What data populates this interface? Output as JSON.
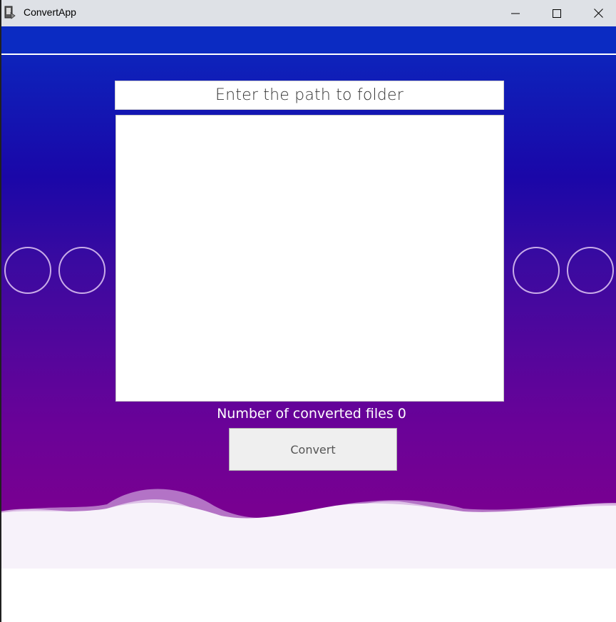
{
  "window": {
    "title": "ConvertApp",
    "controls": [
      "minimize",
      "maximize",
      "close"
    ]
  },
  "main": {
    "path_header": "Enter the path to folder",
    "path_input_value": "",
    "converted_label": "Number of converted files",
    "converted_count": "0",
    "convert_button": "Convert"
  },
  "colors": {
    "gradient_top": "#0a2ac0",
    "gradient_bottom": "#7a0090",
    "wave": "#e9d8f2"
  }
}
